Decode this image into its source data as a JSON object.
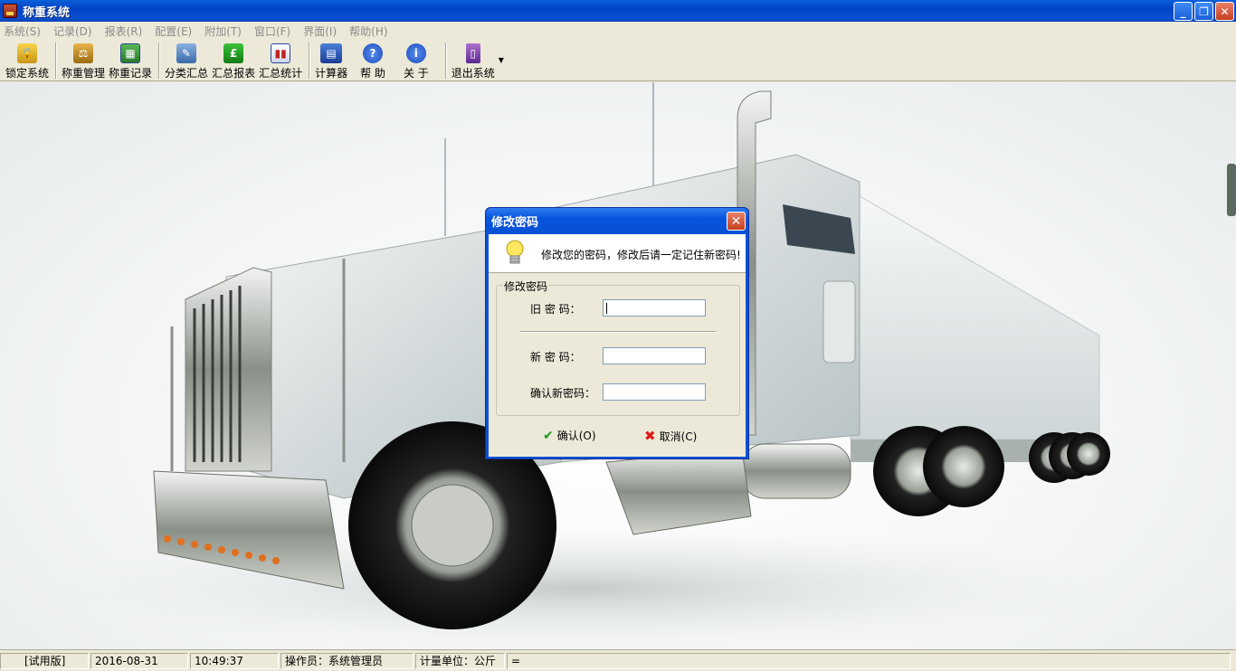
{
  "window": {
    "title": "称重系统"
  },
  "menu": [
    "系统(S)",
    "记录(D)",
    "报表(R)",
    "配置(E)",
    "附加(T)",
    "窗口(F)",
    "界面(I)",
    "帮助(H)"
  ],
  "toolbar": {
    "lock": "锁定系统",
    "weigh_manage": "称重管理",
    "weigh_record": "称重记录",
    "category_summary": "分类汇总",
    "summary_report": "汇总报表",
    "summary_stats": "汇总统计",
    "calculator": "计算器",
    "help": "帮 助",
    "about": "关 于",
    "exit": "退出系统"
  },
  "dialog": {
    "title": "修改密码",
    "message": "修改您的密码，修改后请一定记住新密码!",
    "group_title": "修改密码",
    "old_password_label": "旧  密  码：",
    "new_password_label": "新  密  码：",
    "confirm_password_label": "确认新密码：",
    "old_password_value": "",
    "new_password_value": "",
    "confirm_password_value": "",
    "ok_label": "确认(O)",
    "cancel_label": "取消(C)"
  },
  "status": {
    "edition": "[试用版]",
    "date": "2016-08-31",
    "time": "10:49:37",
    "operator": "操作员：系统管理员",
    "unit": "计量单位：公斤",
    "extra": "="
  },
  "colors": {
    "title_bar": "#0a52d6",
    "chrome": "#ece9d8",
    "close_button": "#d4502a"
  }
}
